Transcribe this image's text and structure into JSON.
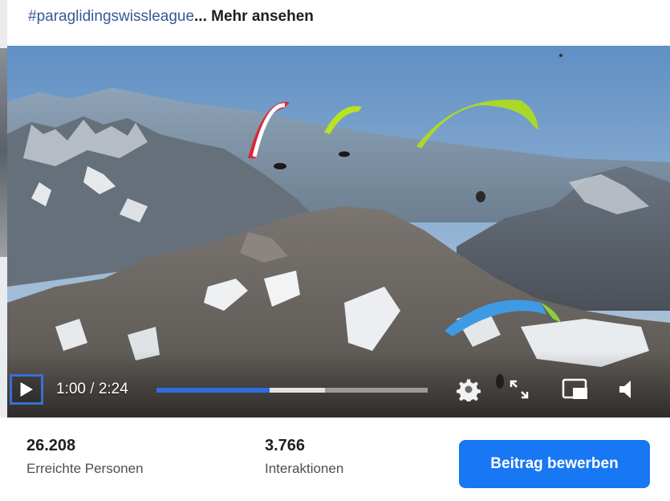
{
  "post": {
    "caption_hashtag": "#paraglidingswissleague",
    "caption_more": "... Mehr ansehen"
  },
  "video": {
    "current_time": "1:00",
    "separator": " / ",
    "duration": "2:24",
    "progress_fraction": 0.4167,
    "buffered_fraction": 0.62,
    "accent_color": "#2f6de1",
    "icons": [
      "play-icon",
      "settings-gear-icon",
      "fullscreen-expand-icon",
      "picture-in-picture-icon",
      "volume-icon"
    ]
  },
  "stats": {
    "reach_value": "26.208",
    "reach_label": "Erreichte Personen",
    "interactions_value": "3.766",
    "interactions_label": "Interaktionen"
  },
  "actions": {
    "boost_label": "Beitrag bewerben",
    "boost_color": "#1877f2"
  }
}
